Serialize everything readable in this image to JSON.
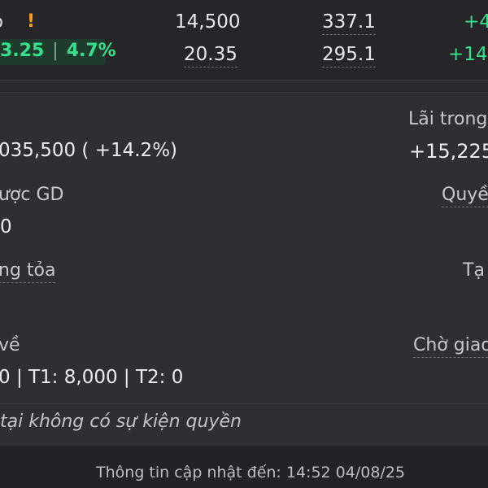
{
  "top_rows": [
    {
      "cell_b": "14,500",
      "cell_c": "337.1",
      "cell_d": "+4"
    },
    {
      "change": "3.25",
      "pct": "4.7%",
      "cell_b": "20.35",
      "cell_c": "295.1",
      "cell_d": "+14."
    }
  ],
  "warning_glyph": "!",
  "info": {
    "total_value": "035,500 ( +14.2%)",
    "profit_label": "Lãi trong",
    "profit_value": "+15,225",
    "tradeable_label": "ược GD",
    "tradeable_value": "0",
    "rights_label": "Quyề",
    "blocked_label": "ng tỏa",
    "temp_label": "Tạ",
    "pending_label": "về",
    "pending_value": "0 | T1: 8,000 | T2: 0",
    "waiting_label": "Chờ giao"
  },
  "notice": "tại không có sự kiện quyền",
  "footer": "Thông tin cập nhật đến: 14:52 04/08/25",
  "colors": {
    "positive": "#35e08a",
    "warning": "#ff9f1c",
    "background": "#2f2f31"
  }
}
